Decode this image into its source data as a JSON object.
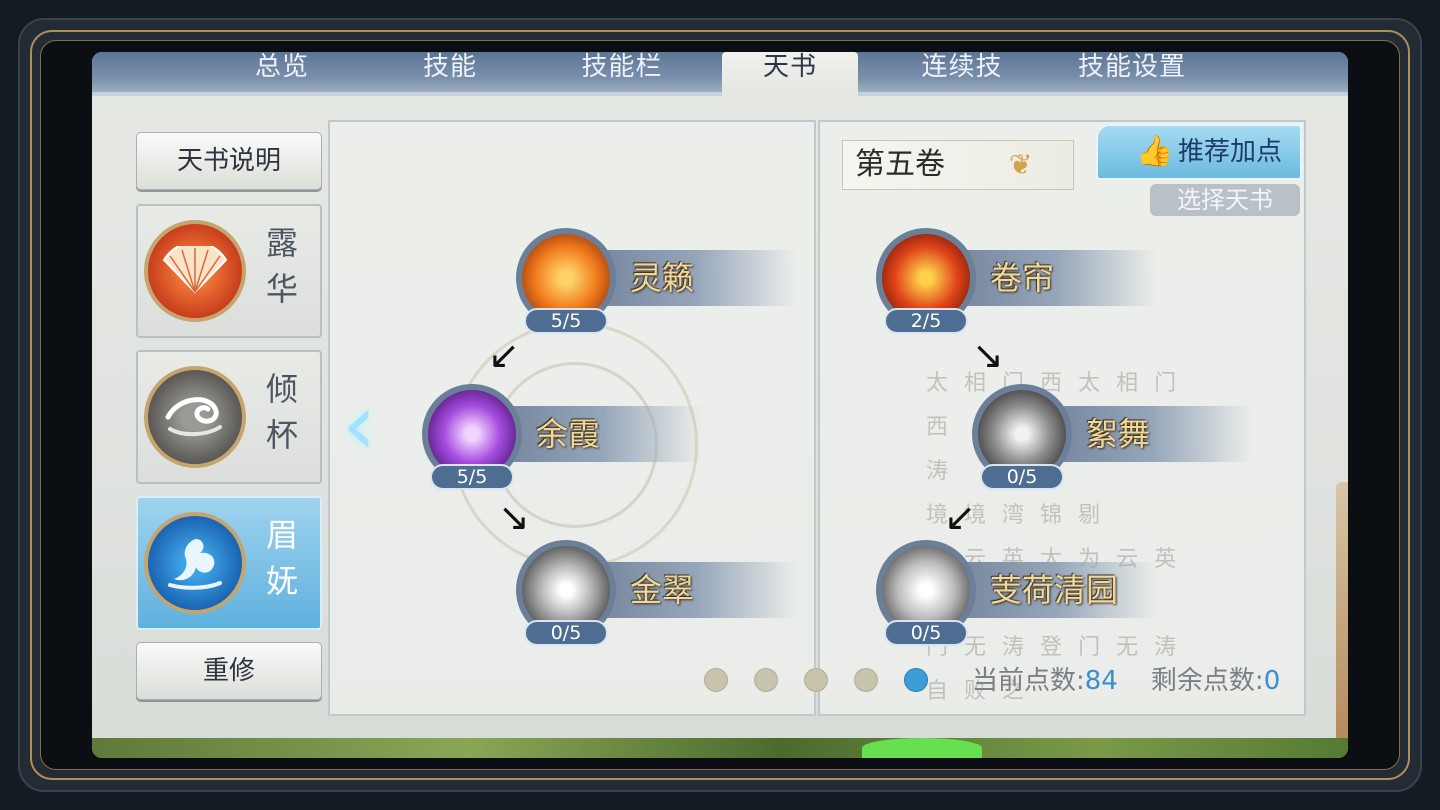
{
  "tabs": [
    {
      "label": "总览",
      "active": false
    },
    {
      "label": "技能",
      "active": false
    },
    {
      "label": "技能栏",
      "active": false
    },
    {
      "label": "天书",
      "active": true
    },
    {
      "label": "连续技",
      "active": false
    },
    {
      "label": "技能设置",
      "active": false
    }
  ],
  "sidebar": {
    "help_label": "天书说明",
    "books": [
      {
        "name": "露华",
        "icon": "fan-icon",
        "active": false
      },
      {
        "name": "倾杯",
        "icon": "swirl-icon",
        "active": false
      },
      {
        "name": "眉妩",
        "icon": "phoenix-icon",
        "active": true
      }
    ],
    "reset_label": "重修"
  },
  "left_panel": {
    "skills": [
      {
        "name": "灵籁",
        "level": "5/5",
        "icon": "fire-claw-icon"
      },
      {
        "name": "余霞",
        "level": "5/5",
        "icon": "purple-lotus-icon"
      },
      {
        "name": "金翠",
        "level": "0/5",
        "icon": "light-burst-icon"
      }
    ]
  },
  "right_panel": {
    "volume_label": "第五卷",
    "recommend_label": "推荐加点",
    "choose_label": "选择天书",
    "skills": [
      {
        "name": "卷帘",
        "level": "2/5",
        "icon": "flame-figure-icon"
      },
      {
        "name": "絮舞",
        "level": "0/5",
        "icon": "dancing-figure-icon"
      },
      {
        "name": "芰荷清园",
        "level": "0/5",
        "icon": "petal-flower-icon"
      }
    ],
    "calligraphy": [
      "太",
      "相",
      "门",
      "西",
      "太",
      "相",
      "门",
      "西",
      "涛",
      "下",
      "达",
      "境",
      "境",
      "湾",
      "锦",
      "剔",
      "为",
      "云",
      "英",
      "太",
      "为",
      "云",
      "英",
      "太",
      "门",
      "无",
      "涛",
      "登",
      "门",
      "无",
      "涛",
      "自",
      "败",
      "之"
    ]
  },
  "pager": {
    "count": 5,
    "active_index": 4
  },
  "points": {
    "current_label": "当前点数:",
    "current_value": "84",
    "remaining_label": "剩余点数:",
    "remaining_value": "0"
  },
  "colors": {
    "accent": "#3d9ed6",
    "gold": "#f1d79a",
    "active_card": "#6bbadf"
  }
}
